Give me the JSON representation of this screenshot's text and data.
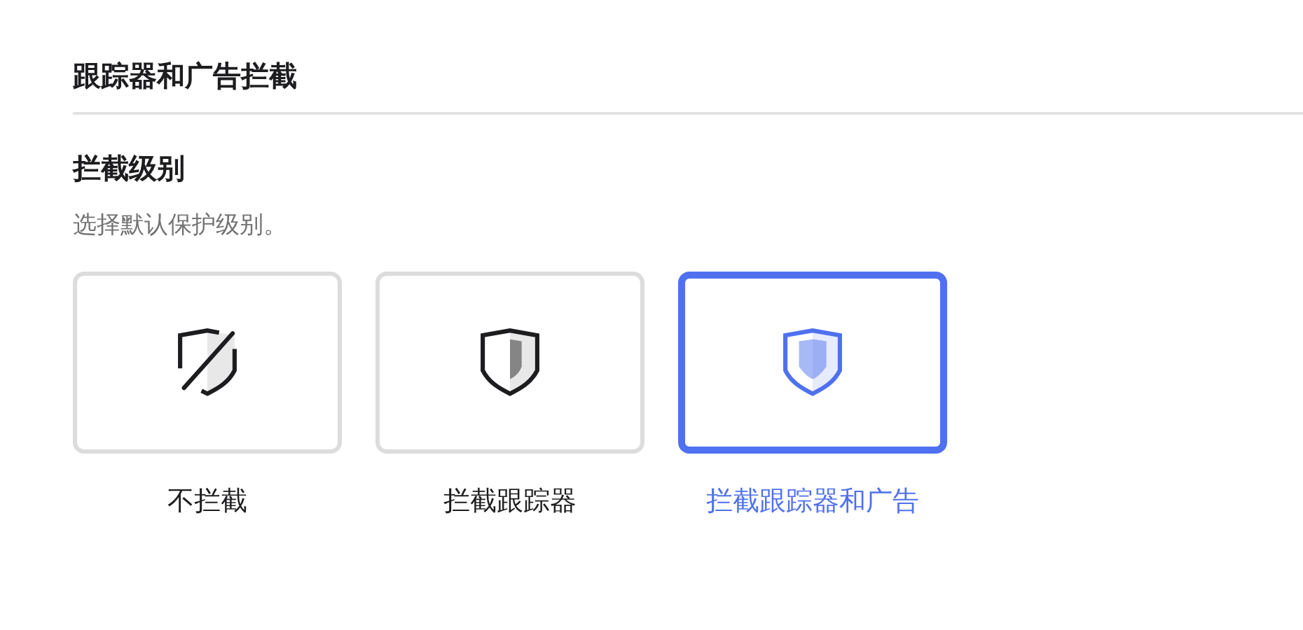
{
  "section_title": "跟踪器和广告拦截",
  "setting": {
    "title": "拦截级别",
    "description": "选择默认保护级别。"
  },
  "options": [
    {
      "kind": "none",
      "label": "不拦截",
      "selected": false
    },
    {
      "kind": "trackers",
      "label": "拦截跟踪器",
      "selected": false
    },
    {
      "kind": "all",
      "label": "拦截跟踪器和广告",
      "selected": true
    }
  ]
}
